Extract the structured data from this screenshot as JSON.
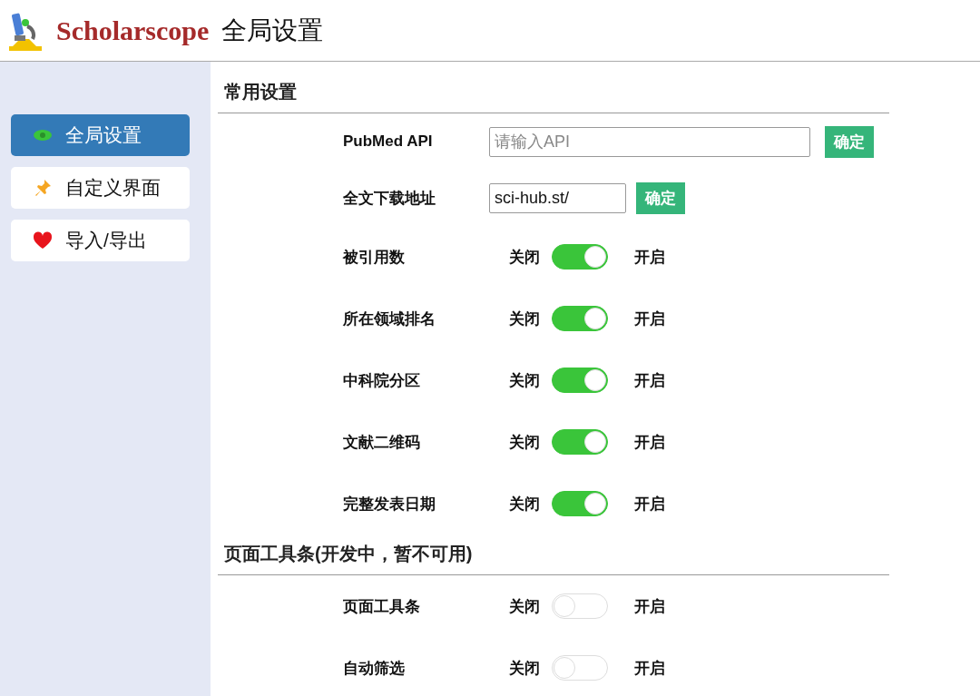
{
  "header": {
    "brand": "Scholarscope",
    "title": "全局设置"
  },
  "sidebar": {
    "items": [
      {
        "label": "全局设置",
        "selected": true
      },
      {
        "label": "自定义界面",
        "selected": false
      },
      {
        "label": "导入/导出",
        "selected": false
      }
    ]
  },
  "sections": [
    {
      "title": "常用设置",
      "rows": [
        {
          "kind": "input",
          "label": "PubMed API",
          "placeholder": "请输入API",
          "button": "确定"
        },
        {
          "kind": "input",
          "label": "全文下载地址",
          "value": "sci-hub.st/",
          "button": "确定"
        },
        {
          "kind": "toggle",
          "label": "被引用数",
          "off_label": "关闭",
          "on_label": "开启",
          "on": true
        },
        {
          "kind": "toggle",
          "label": "所在领域排名",
          "off_label": "关闭",
          "on_label": "开启",
          "on": true
        },
        {
          "kind": "toggle",
          "label": "中科院分区",
          "off_label": "关闭",
          "on_label": "开启",
          "on": true
        },
        {
          "kind": "toggle",
          "label": "文献二维码",
          "off_label": "关闭",
          "on_label": "开启",
          "on": true
        },
        {
          "kind": "toggle",
          "label": "完整发表日期",
          "off_label": "关闭",
          "on_label": "开启",
          "on": true
        }
      ]
    },
    {
      "title": "页面工具条(开发中，暂不可用)",
      "rows": [
        {
          "kind": "toggle",
          "label": "页面工具条",
          "off_label": "关闭",
          "on_label": "开启",
          "on": false
        },
        {
          "kind": "toggle",
          "label": "自动筛选",
          "off_label": "关闭",
          "on_label": "开启",
          "on": false
        }
      ]
    }
  ]
}
